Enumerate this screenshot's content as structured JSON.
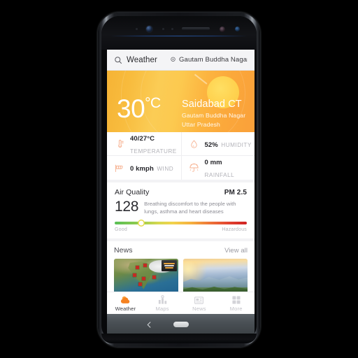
{
  "search": {
    "icon": "search-icon",
    "query": "Weather",
    "location_icon": "location-pin-icon",
    "location": "Gautam Buddha Nagar"
  },
  "hero": {
    "temperature": "30",
    "unit": "°C",
    "station": "Saidabad CT",
    "district": "Gautam Buddha Nagar",
    "state": "Uttar Pradesh",
    "icon": "sun-icon",
    "gradient_from": "#f5b335",
    "gradient_to": "#faa03a",
    "sun_color": "#ffd24f"
  },
  "stats": [
    {
      "icon": "thermometer-icon",
      "value": "40/27°C",
      "label": "TEMPERATURE"
    },
    {
      "icon": "water-droplet-icon",
      "value": "52%",
      "label": "HUMIDITY"
    },
    {
      "icon": "windsock-icon",
      "value": "0 kmph",
      "label": "WIND"
    },
    {
      "icon": "umbrella-rain-icon",
      "value": "0 mm",
      "label": "RAINFALL"
    }
  ],
  "air_quality": {
    "title": "Air Quality",
    "pollutant": "PM 2.5",
    "value": "128",
    "description": "Breathing discomfort to the people with lungs, asthma and heart diseases",
    "scale_low": "Good",
    "scale_high": "Hazardous",
    "marker_position_pct": 20,
    "gradient_colors": [
      "#58bf55",
      "#d6d84f",
      "#f5b03f",
      "#cf2222"
    ]
  },
  "news": {
    "title": "News",
    "view_all": "View all",
    "cards": [
      {
        "name": "india-satellite-map-card",
        "alt": "Satellite map of India with red location markers and Make in India badge"
      },
      {
        "name": "hot-air-balloons-card",
        "alt": "Hot air balloons drifting over sunlit mountain valley"
      }
    ]
  },
  "tabbar": {
    "active": "Weather",
    "items": [
      {
        "icon": "cloud-sun-icon",
        "label": "Weather",
        "active": true
      },
      {
        "icon": "map-chart-icon",
        "label": "Maps",
        "active": false
      },
      {
        "icon": "newspaper-icon",
        "label": "News",
        "active": false
      },
      {
        "icon": "grid-squares-icon",
        "label": "More",
        "active": false
      }
    ],
    "active_color": "#f58220",
    "inactive_color": "#c3c3c9"
  },
  "device": {
    "nav_back_icon": "chevron-left-icon",
    "nav_home_icon": "home-pill-icon",
    "front_camera_icon": "front-camera-icon",
    "earpiece_icon": "speaker-grille-icon"
  }
}
